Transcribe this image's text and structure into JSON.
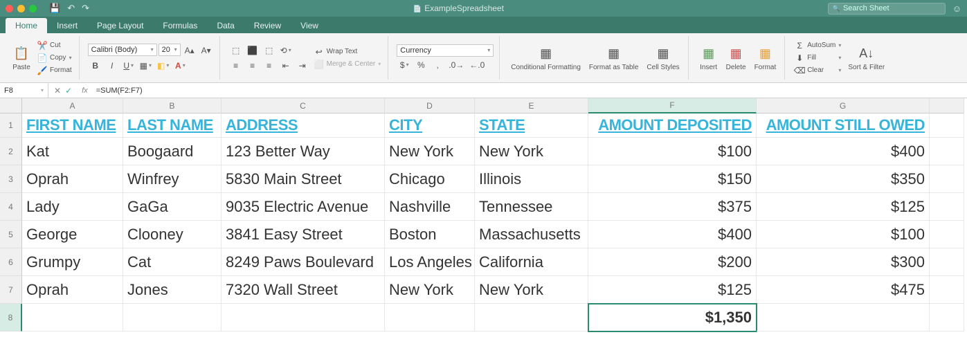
{
  "title": "ExampleSpreadsheet",
  "search_placeholder": "Search Sheet",
  "tabs": [
    "Home",
    "Insert",
    "Page Layout",
    "Formulas",
    "Data",
    "Review",
    "View"
  ],
  "active_tab": 0,
  "ribbon": {
    "paste": "Paste",
    "cut": "Cut",
    "copy": "Copy",
    "format": "Format",
    "font_name": "Calibri (Body)",
    "font_size": "20",
    "wrap": "Wrap Text",
    "merge": "Merge & Center",
    "number_fmt": "Currency",
    "cond": "Conditional Formatting",
    "fat": "Format as Table",
    "cstyles": "Cell Styles",
    "insert": "Insert",
    "delete": "Delete",
    "format2": "Format",
    "autosum": "AutoSum",
    "fill": "Fill",
    "clear": "Clear",
    "sortfilter": "Sort & Filter"
  },
  "formula": {
    "cellref": "F8",
    "text": "=SUM(F2:F7)"
  },
  "columns": [
    "A",
    "B",
    "C",
    "D",
    "E",
    "F",
    "G"
  ],
  "col_widths": [
    "cA",
    "cB",
    "cC",
    "cD",
    "cE",
    "cF",
    "cG"
  ],
  "selected_col": 5,
  "selected_row": 8,
  "headers": [
    "FIRST NAME",
    "LAST NAME",
    "ADDRESS",
    "CITY",
    "STATE",
    "AMOUNT DEPOSITED",
    "AMOUNT STILL OWED"
  ],
  "rows": [
    {
      "r": 2,
      "c": [
        "Kat",
        "Boogaard",
        "123 Better Way",
        "New York",
        "New York",
        "$100",
        "$400"
      ]
    },
    {
      "r": 3,
      "c": [
        "Oprah",
        "Winfrey",
        "5830 Main Street",
        "Chicago",
        "Illinois",
        "$150",
        "$350"
      ]
    },
    {
      "r": 4,
      "c": [
        "Lady",
        "GaGa",
        "9035 Electric Avenue",
        "Nashville",
        "Tennessee",
        "$375",
        "$125"
      ]
    },
    {
      "r": 5,
      "c": [
        "George",
        "Clooney",
        "3841 Easy Street",
        "Boston",
        "Massachusetts",
        "$400",
        "$100"
      ]
    },
    {
      "r": 6,
      "c": [
        "Grumpy",
        "Cat",
        "8249 Paws Boulevard",
        "Los Angeles",
        "California",
        "$200",
        "$300"
      ]
    },
    {
      "r": 7,
      "c": [
        "Oprah",
        "Jones",
        "7320 Wall Street",
        "New York",
        "New York",
        "$125",
        "$475"
      ]
    }
  ],
  "sum_row": {
    "r": 8,
    "F": "$1,350"
  }
}
